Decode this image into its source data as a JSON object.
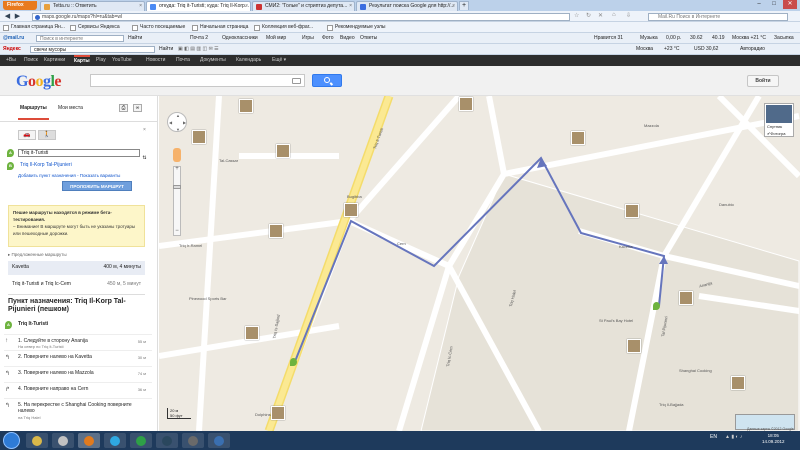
{
  "browser": {
    "menu_button": "Firefox",
    "tabs": [
      {
        "label": "Tetta.ru :: Ответить",
        "active": false
      },
      {
        "label": "откуда: Triq it-Turisti; куда: Triq Il-Korp...",
        "active": true
      },
      {
        "label": "СМИ2: \"Голые\" и стриптиз депута...",
        "active": false
      },
      {
        "label": "Результат поиска Google для http://...",
        "active": false
      }
    ],
    "new_tab": "+",
    "window_controls": [
      "–",
      "□",
      "✕"
    ],
    "url": "maps.google.ru/maps?hl=ru&tab=wl",
    "search_placeholder": "Mail.Ru Поиск в Интернете",
    "bookmarks": [
      "Главная страница Ян...",
      "Сервисы Яндекса",
      "Часто посещаемые",
      "Начальная страница",
      "Коллекция веб-фраг...",
      "Рекомендуемые узлы"
    ],
    "toolbar1": {
      "mail_logo": "@mail.ru",
      "search_placeholder": "Поиск в интернете",
      "find_label": "Найти",
      "items": [
        "Почта 2",
        "Одноклассники",
        "Мой мир",
        "Игры",
        "Фото",
        "Видео",
        "Ответы"
      ],
      "right_items": [
        "Нравится 31",
        "Музыка",
        "0,00 р.",
        "30.62",
        "40.19",
        "Москва +21 °C",
        "Засыпка"
      ]
    },
    "toolbar2": {
      "yandex_logo": "Яндекс",
      "search_value": "свечи мусоры",
      "find_label": "Найти",
      "right_items": [
        "Москва",
        "+23 °C",
        "USD 30,62",
        "Авторадио"
      ]
    }
  },
  "google_bar": {
    "items": [
      "+Вы",
      "Поиск",
      "Картинки",
      "Карты",
      "Play",
      "YouTube",
      "Новости",
      "Почта",
      "Документы",
      "Календарь",
      "Ещё"
    ],
    "selected": "Карты"
  },
  "header": {
    "logo": [
      "G",
      "o",
      "o",
      "g",
      "l",
      "e"
    ],
    "logo_colors": [
      "#3b6de0",
      "#d6332b",
      "#f2b01e",
      "#3b6de0",
      "#2ea047",
      "#d6332b"
    ],
    "signin": "Войти"
  },
  "sidebar": {
    "tab_routes": "Маршруты",
    "tab_places": "Мои места",
    "mode_car": "🚗",
    "mode_walk": "🚶",
    "waypoint_a": {
      "letter": "A",
      "value": "Triq it-Turisti"
    },
    "waypoint_b": {
      "letter": "B",
      "value": "Triq Il-Korp Tal-Pijunieri"
    },
    "add_links": "Добавить пункт назначения - Показать варианты",
    "route_button": "ПРОЛОЖИТЬ МАРШРУТ",
    "warning": {
      "title": "Пешие маршруты находятся в режиме бета-тестирования.",
      "body": "– Внимание! В маршруте могут быть не указаны тротуары или пешеходные дорожки."
    },
    "suggested_title": "Предложенные маршруты",
    "routes": [
      {
        "name": "Kavetta",
        "info": "400 м, 4 минуты"
      },
      {
        "name": "Triq it-Turisti и Triq Ic-Cem",
        "info": "450 м, 5 минут"
      }
    ],
    "destination_title": "Пункт назначения: Triq Il-Korp Tal-Pijunieri (пешком)",
    "start_label": "Triq It-Turisti",
    "steps": [
      {
        "num": "1.",
        "text": "Следуйте в сторону Ananija",
        "sub": "На север по Triq it-Turisti",
        "dist": "55 м"
      },
      {
        "num": "2.",
        "text": "Поверните налево на Kavetta",
        "sub": "",
        "dist": "30 м"
      },
      {
        "num": "3.",
        "text": "Поверните налево на Mazzola",
        "sub": "",
        "dist": "74 м"
      },
      {
        "num": "4.",
        "text": "Поверните направо на Cern",
        "sub": "",
        "dist": "36 м"
      },
      {
        "num": "5.",
        "text": "На перекрестке с Shanghai Cooking поверните налево",
        "sub": "на Triq Halel",
        "dist": ""
      }
    ]
  },
  "map": {
    "streets": [
      {
        "name": "Triq It-Turisti",
        "rot": -62
      },
      {
        "name": "Mazzola",
        "rot": 0
      },
      {
        "name": "Kavetta",
        "rot": 0
      },
      {
        "name": "Cern",
        "rot": 0
      },
      {
        "name": "Triq Halel",
        "rot": -70
      },
      {
        "name": "Ananija",
        "rot": -20
      },
      {
        "name": "Triq Ir-Ramel",
        "rot": 0
      },
      {
        "name": "Tal-Pijunieri",
        "rot": -80
      },
      {
        "name": "Triq Is-Sajjied",
        "rot": -80
      },
      {
        "name": "Triq Ic-Cem",
        "rot": -80
      }
    ],
    "pois": [
      "Tal-Cassar",
      "St Paul's Bay Hotel",
      "Bugibba",
      "Danubio",
      "Shanghai Cooking",
      "Pinewood Sports Bar",
      "Triq Il-Bajjada",
      "Dolphins"
    ],
    "route_color": "#6675bd",
    "satellite": "Спутник",
    "photos_check": "Фотогра",
    "scale_m": "20 м",
    "scale_ft": "50 фут",
    "copyright": "Данные карты ©2012 Google"
  },
  "taskbar": {
    "apps": [
      {
        "name": "explorer",
        "color": "#d9b84a"
      },
      {
        "name": "media",
        "color": "#c2c2c2"
      },
      {
        "name": "firefox",
        "color": "#e07a1e"
      },
      {
        "name": "skype",
        "color": "#2fa9e1"
      },
      {
        "name": "chrome",
        "color": "#2ea047"
      },
      {
        "name": "steam",
        "color": "#2a475e"
      },
      {
        "name": "app7",
        "color": "#6a6a6a"
      },
      {
        "name": "app8",
        "color": "#3a6fb0"
      }
    ],
    "lang": "EN",
    "time": "18:05",
    "date": "14.09.2012"
  }
}
